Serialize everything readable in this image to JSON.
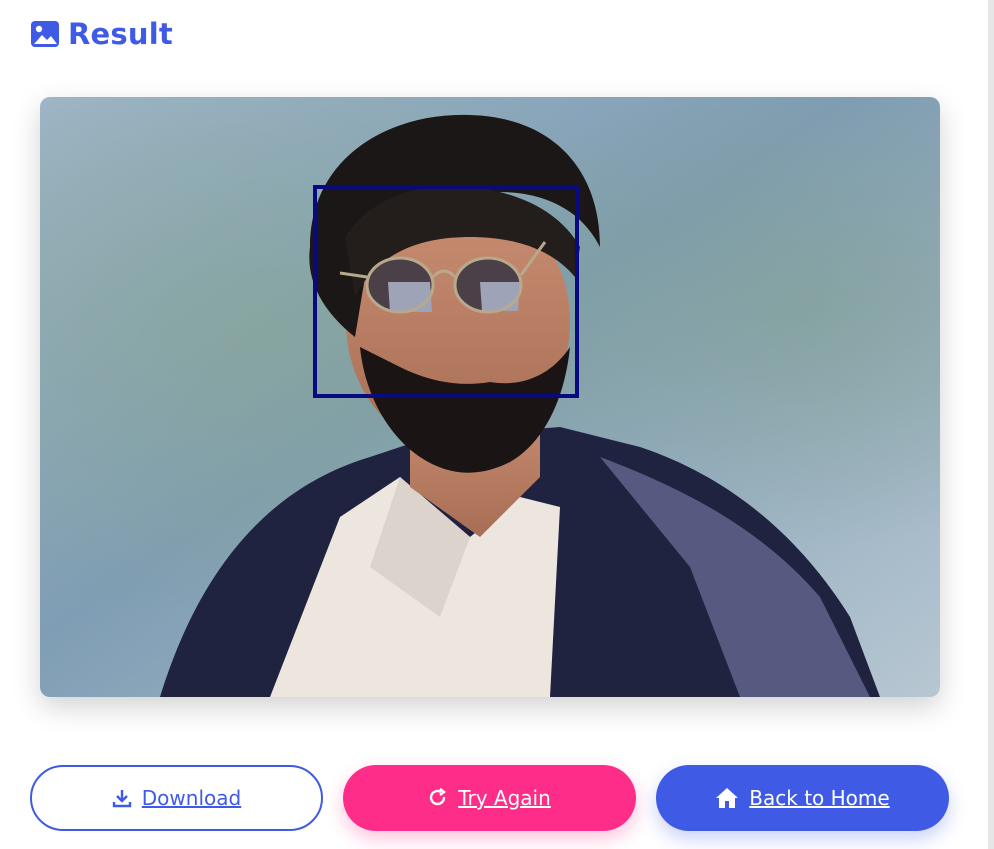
{
  "header": {
    "icon": "image-icon",
    "title": "Result"
  },
  "result_image": {
    "description_icon": "photo-with-face-detection-box",
    "detection_box_color": "#0a0a80"
  },
  "actions": {
    "download": {
      "label": "Download",
      "icon": "download-icon"
    },
    "try_again": {
      "label": "Try Again",
      "icon": "redo-icon"
    },
    "back_home": {
      "label": "Back to Home",
      "icon": "home-icon"
    }
  },
  "colors": {
    "primary": "#3f5be6",
    "accent": "#ff2d8a",
    "white": "#ffffff"
  }
}
